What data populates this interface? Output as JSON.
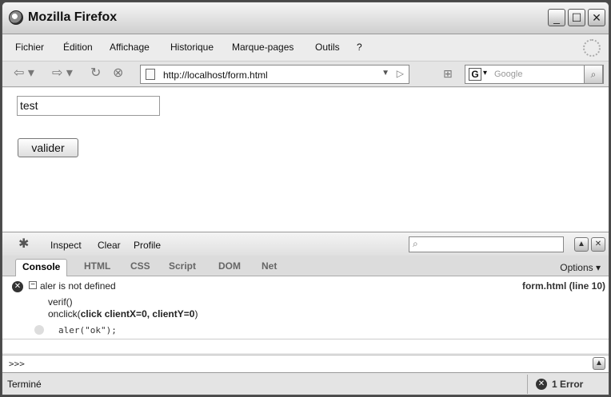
{
  "window": {
    "title": "Mozilla Firefox",
    "minimize": "_",
    "maximize": "☐",
    "close": "✕"
  },
  "menu": {
    "items": [
      "Fichier",
      "Édition",
      "Affichage",
      "Historique",
      "Marque-pages",
      "Outils",
      "?"
    ]
  },
  "navbar": {
    "back_icon": "back-icon",
    "forward_icon": "forward-icon",
    "url": "http://localhost/form.html",
    "search_engine": "G",
    "search_placeholder": "Google"
  },
  "page": {
    "input_value": "test",
    "button_label": "valider"
  },
  "firebug": {
    "toolbar": [
      "Inspect",
      "Clear",
      "Profile"
    ],
    "tabs": [
      "Console",
      "HTML",
      "CSS",
      "Script",
      "DOM",
      "Net"
    ],
    "active_tab": "Console",
    "options_label": "Options ▾",
    "error": {
      "message": "aler is not defined",
      "source": "form.html (line 10)",
      "stack_line1": "verif()",
      "stack_line2_prefix": "onclick(",
      "stack_line2_bold": "click clientX=0, clientY=0",
      "stack_line2_suffix": ")",
      "code": "aler(\"ok\");"
    },
    "prompt": ">>>"
  },
  "status": {
    "text": "Terminé",
    "error_count": "1 Error"
  }
}
